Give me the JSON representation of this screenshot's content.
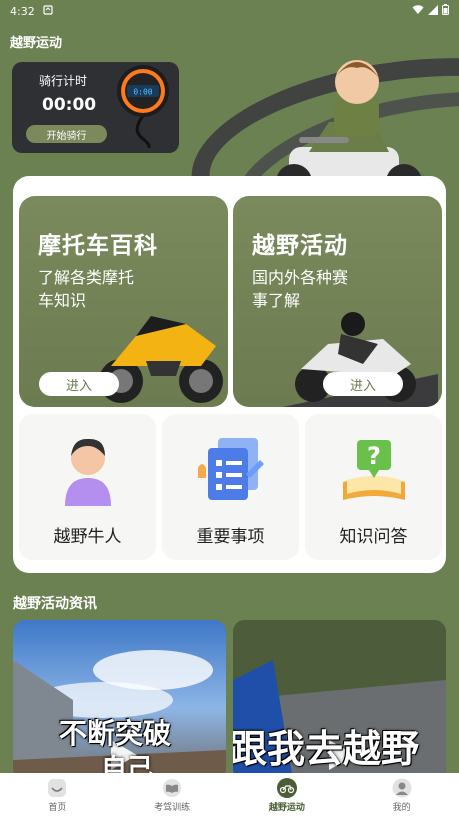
{
  "status_bar": {
    "time": "4:32"
  },
  "page": {
    "title": "越野运动"
  },
  "timer": {
    "label": "骑行计时",
    "value": "00:00",
    "start_label": "开始骑行",
    "watch_display": "0:00"
  },
  "features": [
    {
      "title": "摩托车百科",
      "desc": "了解各类摩托车知识",
      "button": "进入"
    },
    {
      "title": "越野活动",
      "desc": "国内外各种赛事了解",
      "button": "进入"
    }
  ],
  "tiles": [
    {
      "label": "越野牛人",
      "icon": "person-icon"
    },
    {
      "label": "重要事项",
      "icon": "checklist-icon"
    },
    {
      "label": "知识问答",
      "icon": "qa-book-icon"
    }
  ],
  "news": {
    "title": "越野活动资讯",
    "videos": [
      {
        "caption": "不断突破",
        "caption2": "自己"
      },
      {
        "caption": "跟我去越野"
      }
    ]
  },
  "tabs": [
    {
      "label": "首页",
      "icon": "home-icon",
      "active": false
    },
    {
      "label": "考驾训练",
      "icon": "book-icon",
      "active": false
    },
    {
      "label": "越野运动",
      "icon": "motorcycle-icon",
      "active": true
    },
    {
      "label": "我的",
      "icon": "profile-icon",
      "active": false
    }
  ],
  "colors": {
    "background": "#6b8152",
    "accent": "#4d5e36",
    "card": "#ffffff"
  }
}
